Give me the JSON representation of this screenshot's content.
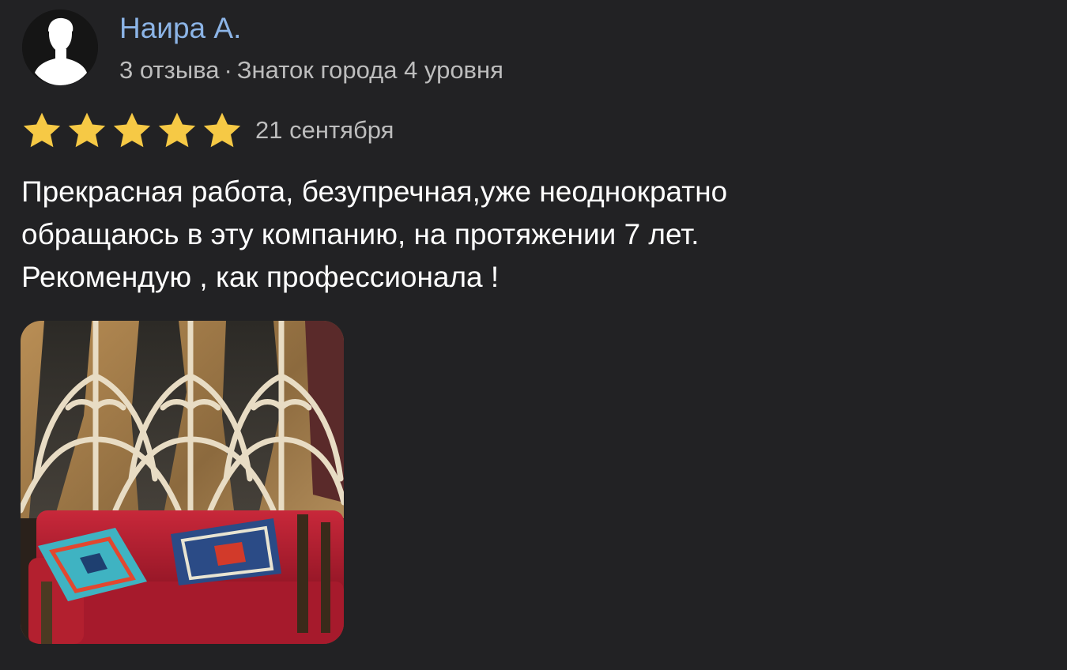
{
  "review": {
    "author": {
      "name": "Наира А.",
      "reviews_count": "3 отзыва",
      "separator": "·",
      "level": "Знаток города 4 уровня",
      "avatar_icon": "user-silhouette-icon"
    },
    "rating": {
      "stars": 5,
      "max": 5,
      "star_color": "#f6c945",
      "star_icon": "star-icon"
    },
    "date": "21 сентября",
    "text": "Прекрасная работа, безупречная,уже неоднократно\nобращаюсь в эту компанию, на протяжении 7 лет.\nРекомендую , как профессионала !",
    "photo": {
      "description_icon": "photo-thumbnail"
    }
  },
  "colors": {
    "background": "#222224",
    "author_name": "#8cb4e6",
    "meta_text": "#bdbdbd",
    "body_text": "#ffffff"
  }
}
